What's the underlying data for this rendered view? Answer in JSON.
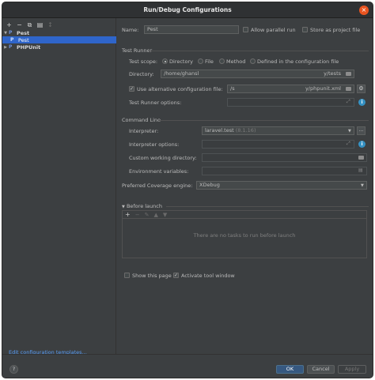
{
  "window": {
    "title": "Run/Debug Configurations"
  },
  "toolbar": {
    "add": "+",
    "remove": "−",
    "copy": "⧉",
    "folder": "▤",
    "sort": "↕"
  },
  "tree": {
    "items": [
      {
        "label": "Pest"
      },
      {
        "label": "Pest"
      },
      {
        "label": "PHPUnit"
      }
    ]
  },
  "edit_templates": "Edit configuration templates...",
  "form": {
    "name_label": "Name:",
    "name_value": "Pest",
    "allow_parallel": "Allow parallel run",
    "store_project": "Store as project file",
    "test_runner_section": "Test Runner",
    "test_scope_label": "Test scope:",
    "scope_options": [
      "Directory",
      "File",
      "Method",
      "Defined in the configuration file"
    ],
    "directory_label": "Directory:",
    "directory_value_left": "/home/ghansl",
    "directory_value_right": "y/tests",
    "use_alt_config": "Use alternative configuration file:",
    "alt_config_left": "/s",
    "alt_config_right": "y/phpunit.xml",
    "runner_options_label": "Test Runner options:",
    "command_line_section": "Command Line",
    "interpreter_label": "Interpreter:",
    "interpreter_value": "laravel.test",
    "interpreter_version": "(8.1.16)",
    "interpreter_options_label": "Interpreter options:",
    "custom_wd_label": "Custom working directory:",
    "env_vars_label": "Environment variables:",
    "coverage_label": "Preferred Coverage engine:",
    "coverage_value": "XDebug",
    "before_launch": "Before launch",
    "no_tasks": "There are no tasks to run before launch",
    "show_page": "Show this page",
    "activate_tool": "Activate tool window"
  },
  "buttons": {
    "help": "?",
    "ok": "OK",
    "cancel": "Cancel",
    "apply": "Apply"
  },
  "colors": {
    "accent": "#2f65ca",
    "link": "#589df6",
    "primary_button": "#365880",
    "info": "#3592c4"
  }
}
